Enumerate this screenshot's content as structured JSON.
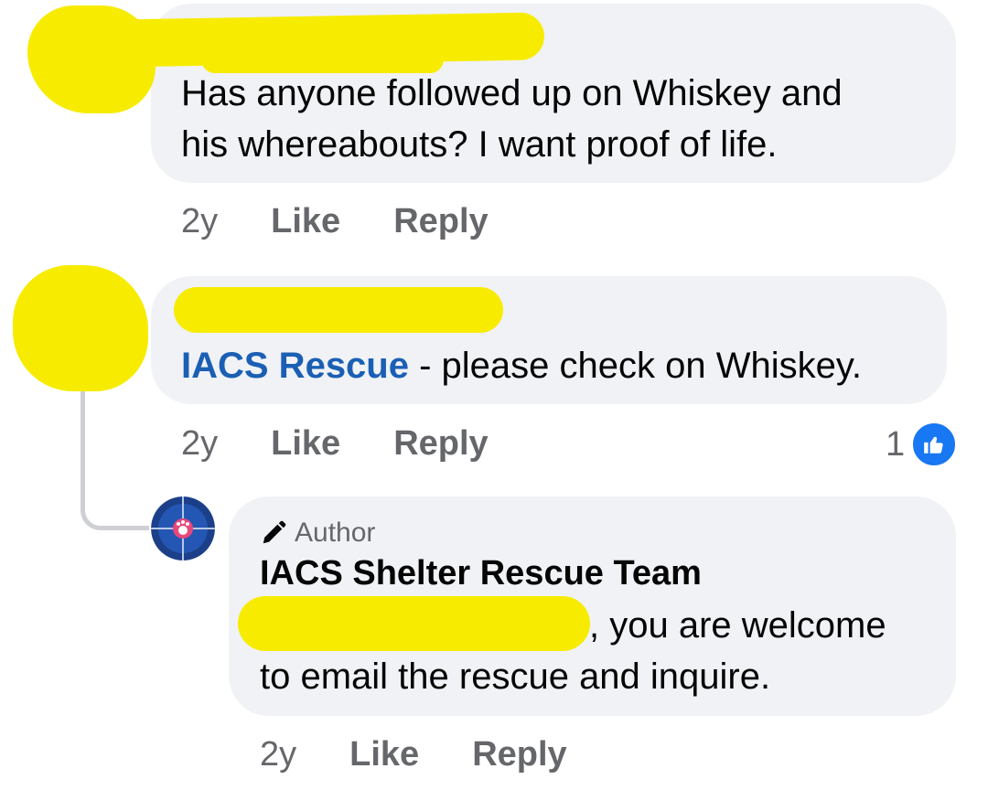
{
  "comments": [
    {
      "text_line1": "Has anyone followed up on Whiskey and",
      "text_line2": "his whereabouts?  I want proof of life.",
      "time": "2y",
      "like_label": "Like",
      "reply_label": "Reply"
    },
    {
      "mention": "IACS Rescue",
      "text": " - please check on Whiskey.",
      "time": "2y",
      "like_label": "Like",
      "reply_label": "Reply",
      "reaction_count": "1"
    }
  ],
  "reply": {
    "badge_label": "Author",
    "author": "IACS Shelter Rescue Team",
    "text_line1": ", you are welcome",
    "text_line2": "to email the rescue and inquire.",
    "time": "2y",
    "like_label": "Like",
    "reply_label": "Reply"
  },
  "icons": {
    "author_badge": "pencil-icon",
    "reaction": "thumbs-up-icon"
  },
  "colors": {
    "bubble": "#f0f2f5",
    "mention": "#1b5fb4",
    "like_badge": "#1877f2",
    "redaction": "#f7ec00",
    "meta_text": "#65676b"
  }
}
